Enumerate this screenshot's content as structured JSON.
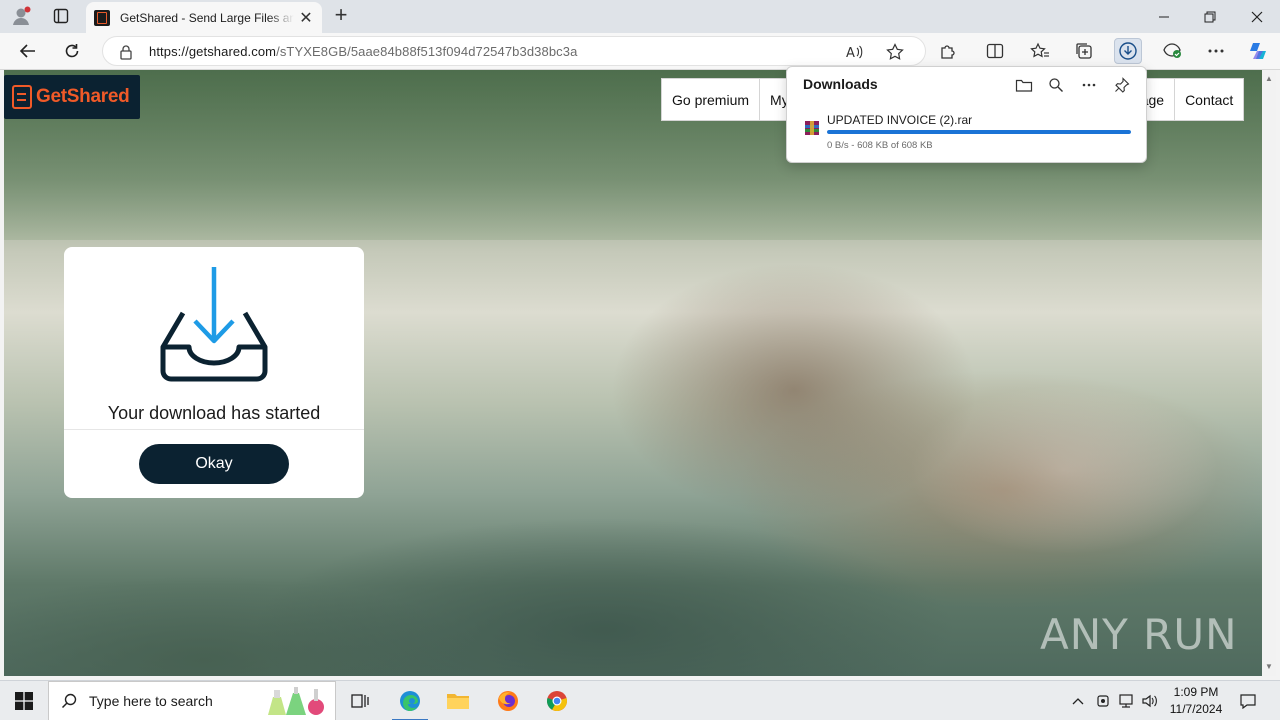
{
  "browser": {
    "tab_title": "GetShared - Send Large Files and Folders",
    "url_host": "https://getshared.com",
    "url_path": "/sTYXE8GB/5aae84b88f513f094d72547b3d38bc3a"
  },
  "page": {
    "logo_text": "GetShared",
    "nav": [
      "Go premium",
      "My",
      "age",
      "Contact"
    ],
    "modal": {
      "message": "Your download has started",
      "button": "Okay"
    },
    "watermark": "ANY RUN"
  },
  "downloads": {
    "title": "Downloads",
    "items": [
      {
        "file_name": "UPDATED INVOICE (2).rar",
        "status": "0 B/s - 608 KB of 608 KB",
        "progress": 1.0
      }
    ]
  },
  "taskbar": {
    "search_placeholder": "Type here to search",
    "time": "1:09 PM",
    "date": "11/7/2024"
  },
  "colors": {
    "brand_orange": "#f05a28",
    "brand_navy": "#0b2231",
    "download_blue": "#1a73d6",
    "icon_arrow_blue": "#1e9be6"
  }
}
